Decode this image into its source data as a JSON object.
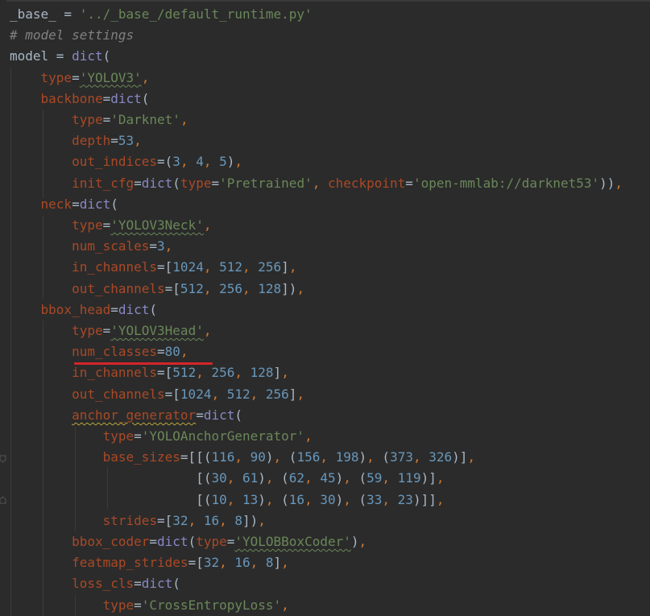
{
  "editor": {
    "language": "python",
    "colors": {
      "background": "#2b2b2b",
      "default": "#a9b7c6",
      "keyword_punct": "#cc7832",
      "string": "#6a8759",
      "number": "#6897bb",
      "comment": "#808080",
      "argument": "#aa4926",
      "builtin": "#8888c6",
      "highlight_underline": "#d3262b"
    },
    "lines": [
      [
        [
          "k",
          "_base_ = "
        ],
        [
          "s",
          "'../_base_/default_runtime.py'"
        ]
      ],
      [
        [
          "c",
          "# model settings"
        ]
      ],
      [
        [
          "k",
          "model = "
        ],
        [
          "f",
          "dict"
        ],
        [
          "k",
          "("
        ]
      ],
      [
        [
          "k",
          "    "
        ],
        [
          "a",
          "type"
        ],
        [
          "k",
          "="
        ],
        [
          "s",
          "'YOLOV3'"
        ],
        [
          "p",
          ","
        ]
      ],
      [
        [
          "k",
          "    "
        ],
        [
          "a",
          "backbone"
        ],
        [
          "k",
          "="
        ],
        [
          "f",
          "dict"
        ],
        [
          "k",
          "("
        ]
      ],
      [
        [
          "k",
          "        "
        ],
        [
          "a",
          "type"
        ],
        [
          "k",
          "="
        ],
        [
          "s",
          "'Darknet'"
        ],
        [
          "p",
          ","
        ]
      ],
      [
        [
          "k",
          "        "
        ],
        [
          "a",
          "depth"
        ],
        [
          "k",
          "="
        ],
        [
          "n",
          "53"
        ],
        [
          "p",
          ","
        ]
      ],
      [
        [
          "k",
          "        "
        ],
        [
          "a",
          "out_indices"
        ],
        [
          "k",
          "=("
        ],
        [
          "n",
          "3"
        ],
        [
          "p",
          ", "
        ],
        [
          "n",
          "4"
        ],
        [
          "p",
          ", "
        ],
        [
          "n",
          "5"
        ],
        [
          "k",
          ")"
        ],
        [
          "p",
          ","
        ]
      ],
      [
        [
          "k",
          "        "
        ],
        [
          "a",
          "init_cfg"
        ],
        [
          "k",
          "="
        ],
        [
          "f",
          "dict"
        ],
        [
          "k",
          "("
        ],
        [
          "a",
          "type"
        ],
        [
          "k",
          "="
        ],
        [
          "s",
          "'Pretrained'"
        ],
        [
          "p",
          ", "
        ],
        [
          "a",
          "checkpoint"
        ],
        [
          "k",
          "="
        ],
        [
          "s",
          "'open-mmlab://darknet53'"
        ],
        [
          "k",
          "))"
        ],
        [
          "p",
          ","
        ]
      ],
      [
        [
          "k",
          "    "
        ],
        [
          "a",
          "neck"
        ],
        [
          "k",
          "="
        ],
        [
          "f",
          "dict"
        ],
        [
          "k",
          "("
        ]
      ],
      [
        [
          "k",
          "        "
        ],
        [
          "a",
          "type"
        ],
        [
          "k",
          "="
        ],
        [
          "s",
          "'YOLOV3Neck'"
        ],
        [
          "p",
          ","
        ]
      ],
      [
        [
          "k",
          "        "
        ],
        [
          "a",
          "num_scales"
        ],
        [
          "k",
          "="
        ],
        [
          "n",
          "3"
        ],
        [
          "p",
          ","
        ]
      ],
      [
        [
          "k",
          "        "
        ],
        [
          "a",
          "in_channels"
        ],
        [
          "k",
          "=["
        ],
        [
          "n",
          "1024"
        ],
        [
          "p",
          ", "
        ],
        [
          "n",
          "512"
        ],
        [
          "p",
          ", "
        ],
        [
          "n",
          "256"
        ],
        [
          "k",
          "]"
        ],
        [
          "p",
          ","
        ]
      ],
      [
        [
          "k",
          "        "
        ],
        [
          "a",
          "out_channels"
        ],
        [
          "k",
          "=["
        ],
        [
          "n",
          "512"
        ],
        [
          "p",
          ", "
        ],
        [
          "n",
          "256"
        ],
        [
          "p",
          ", "
        ],
        [
          "n",
          "128"
        ],
        [
          "k",
          "])"
        ],
        [
          "p",
          ","
        ]
      ],
      [
        [
          "k",
          "    "
        ],
        [
          "a",
          "bbox_head"
        ],
        [
          "k",
          "="
        ],
        [
          "f",
          "dict"
        ],
        [
          "k",
          "("
        ]
      ],
      [
        [
          "k",
          "        "
        ],
        [
          "a",
          "type"
        ],
        [
          "k",
          "="
        ],
        [
          "s",
          "'YOLOV3Head'"
        ],
        [
          "p",
          ","
        ]
      ],
      [
        [
          "k",
          "        "
        ],
        [
          "a",
          "num_classes"
        ],
        [
          "k",
          "="
        ],
        [
          "n",
          "80"
        ],
        [
          "p",
          ","
        ]
      ],
      [
        [
          "k",
          "        "
        ],
        [
          "a",
          "in_channels"
        ],
        [
          "k",
          "=["
        ],
        [
          "n",
          "512"
        ],
        [
          "p",
          ", "
        ],
        [
          "n",
          "256"
        ],
        [
          "p",
          ", "
        ],
        [
          "n",
          "128"
        ],
        [
          "k",
          "]"
        ],
        [
          "p",
          ","
        ]
      ],
      [
        [
          "k",
          "        "
        ],
        [
          "a",
          "out_channels"
        ],
        [
          "k",
          "=["
        ],
        [
          "n",
          "1024"
        ],
        [
          "p",
          ", "
        ],
        [
          "n",
          "512"
        ],
        [
          "p",
          ", "
        ],
        [
          "n",
          "256"
        ],
        [
          "k",
          "]"
        ],
        [
          "p",
          ","
        ]
      ],
      [
        [
          "k",
          "        "
        ],
        [
          "a",
          "anchor_generator"
        ],
        [
          "k",
          "="
        ],
        [
          "f",
          "dict"
        ],
        [
          "k",
          "("
        ]
      ],
      [
        [
          "k",
          "            "
        ],
        [
          "a",
          "type"
        ],
        [
          "k",
          "="
        ],
        [
          "s",
          "'YOLOAnchorGenerator'"
        ],
        [
          "p",
          ","
        ]
      ],
      [
        [
          "k",
          "            "
        ],
        [
          "a",
          "base_sizes"
        ],
        [
          "k",
          "=[[("
        ],
        [
          "n",
          "116"
        ],
        [
          "p",
          ", "
        ],
        [
          "n",
          "90"
        ],
        [
          "k",
          ")"
        ],
        [
          "p",
          ", "
        ],
        [
          "k",
          "("
        ],
        [
          "n",
          "156"
        ],
        [
          "p",
          ", "
        ],
        [
          "n",
          "198"
        ],
        [
          "k",
          ")"
        ],
        [
          "p",
          ", "
        ],
        [
          "k",
          "("
        ],
        [
          "n",
          "373"
        ],
        [
          "p",
          ", "
        ],
        [
          "n",
          "326"
        ],
        [
          "k",
          ")]"
        ],
        [
          "p",
          ","
        ]
      ],
      [
        [
          "k",
          "                        [("
        ],
        [
          "n",
          "30"
        ],
        [
          "p",
          ", "
        ],
        [
          "n",
          "61"
        ],
        [
          "k",
          ")"
        ],
        [
          "p",
          ", "
        ],
        [
          "k",
          "("
        ],
        [
          "n",
          "62"
        ],
        [
          "p",
          ", "
        ],
        [
          "n",
          "45"
        ],
        [
          "k",
          ")"
        ],
        [
          "p",
          ", "
        ],
        [
          "k",
          "("
        ],
        [
          "n",
          "59"
        ],
        [
          "p",
          ", "
        ],
        [
          "n",
          "119"
        ],
        [
          "k",
          ")]"
        ],
        [
          "p",
          ","
        ]
      ],
      [
        [
          "k",
          "                        [("
        ],
        [
          "n",
          "10"
        ],
        [
          "p",
          ", "
        ],
        [
          "n",
          "13"
        ],
        [
          "k",
          ")"
        ],
        [
          "p",
          ", "
        ],
        [
          "k",
          "("
        ],
        [
          "n",
          "16"
        ],
        [
          "p",
          ", "
        ],
        [
          "n",
          "30"
        ],
        [
          "k",
          ")"
        ],
        [
          "p",
          ", "
        ],
        [
          "k",
          "("
        ],
        [
          "n",
          "33"
        ],
        [
          "p",
          ", "
        ],
        [
          "n",
          "23"
        ],
        [
          "k",
          ")]]"
        ],
        [
          "p",
          ","
        ]
      ],
      [
        [
          "k",
          "            "
        ],
        [
          "a",
          "strides"
        ],
        [
          "k",
          "=["
        ],
        [
          "n",
          "32"
        ],
        [
          "p",
          ", "
        ],
        [
          "n",
          "16"
        ],
        [
          "p",
          ", "
        ],
        [
          "n",
          "8"
        ],
        [
          "k",
          "])"
        ],
        [
          "p",
          ","
        ]
      ],
      [
        [
          "k",
          "        "
        ],
        [
          "a",
          "bbox_coder"
        ],
        [
          "k",
          "="
        ],
        [
          "f",
          "dict"
        ],
        [
          "k",
          "("
        ],
        [
          "a",
          "type"
        ],
        [
          "k",
          "="
        ],
        [
          "s",
          "'YOLOBBoxCoder'"
        ],
        [
          "k",
          ")"
        ],
        [
          "p",
          ","
        ]
      ],
      [
        [
          "k",
          "        "
        ],
        [
          "a",
          "featmap_strides"
        ],
        [
          "k",
          "=["
        ],
        [
          "n",
          "32"
        ],
        [
          "p",
          ", "
        ],
        [
          "n",
          "16"
        ],
        [
          "p",
          ", "
        ],
        [
          "n",
          "8"
        ],
        [
          "k",
          "]"
        ],
        [
          "p",
          ","
        ]
      ],
      [
        [
          "k",
          "        "
        ],
        [
          "a",
          "loss_cls"
        ],
        [
          "k",
          "="
        ],
        [
          "f",
          "dict"
        ],
        [
          "k",
          "("
        ]
      ],
      [
        [
          "k",
          "            "
        ],
        [
          "a",
          "type"
        ],
        [
          "k",
          "="
        ],
        [
          "s",
          "'CrossEntropyLoss'"
        ],
        [
          "p",
          ","
        ]
      ]
    ]
  }
}
